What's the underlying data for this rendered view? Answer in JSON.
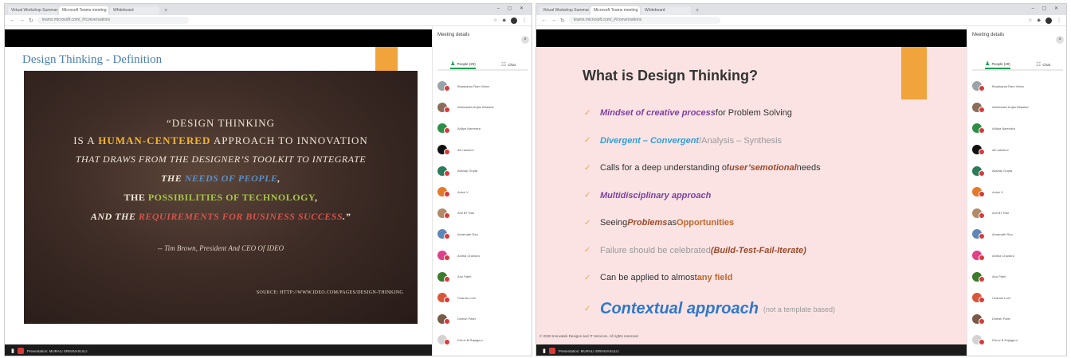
{
  "browser": {
    "tabs": [
      "Virtual Workshop Summary",
      "Microsoft Teams meeting",
      "Whiteboard"
    ],
    "url": "teams.microsoft.com/_#/conversations",
    "new_tab_label": "+",
    "window_controls": "–  ▢  ✕",
    "nav_back": "←",
    "nav_forward": "→",
    "nav_reload": "↻"
  },
  "left_slide": {
    "title": "Design Thinking - Definition",
    "quote_line1": "“DESIGN THINKING",
    "quote_line2_pre": "IS A ",
    "quote_line2_hl": "HUMAN-CENTERED",
    "quote_line2_post": " APPROACH TO INNOVATION",
    "quote_line3": "THAT DRAWS FROM THE DESIGNER’S TOOLKIT TO INTEGRATE",
    "quote_line4_pre": "THE ",
    "quote_line4_hl": "NEEDS OF PEOPLE",
    "quote_line4_post": ",",
    "quote_line5_pre": "THE ",
    "quote_line5_hl": "POSSIBILITIES OF TECHNOLOGY",
    "quote_line5_post": ",",
    "quote_line6_pre": "AND THE ",
    "quote_line6_hl": "REQUIREMENTS FOR BUSINESS SUCCESS",
    "quote_line6_post": ".”",
    "author": "-- Tim Brown, President And CEO Of IDEO",
    "source": "SOURCE: HTTP://WWW.IDEO.COM/PAGES/DESIGN-THINKING"
  },
  "right_slide": {
    "title": "What is Design Thinking?",
    "b1_hl": "Mindset of creative process",
    "b1_rest": " for Problem Solving",
    "b2_hl": "Divergent – Convergent",
    "b2_rest": "/Analysis – Synthesis",
    "b3_pre": "Calls for a deep understanding of ",
    "b3_hl1": "user’s",
    "b3_mid": " ",
    "b3_hl2": "emotional",
    "b3_post": " needs",
    "b4_hl": "Multidisciplinary approach",
    "b5_pre": "Seeing ",
    "b5_hl1": "Problems",
    "b5_mid": " as ",
    "b5_hl2": "Opportunities",
    "b6_pre": "Failure should be celebrated ",
    "b6_hl": "(Build-Test-Fail-Iterate)",
    "b7_pre": "Can be applied to almost ",
    "b7_hl": "any field",
    "b8_hl": "Contextual approach",
    "b8_note": "(not a template based)",
    "tick": "✓",
    "copyright": "© 2020 Innovatek Designs and IT Services. All rights reserved."
  },
  "presenter": {
    "label": "Presentation: MURALI SRINIVASULU"
  },
  "panel": {
    "title": "Meeting details",
    "close": "×",
    "tab_people": "People (20)",
    "tab_chat": "Chat",
    "people_icon": "♟",
    "chat_icon": "☷",
    "participants": [
      {
        "name": "Bhaskaran Ram Velan",
        "color": "#9aa3a8"
      },
      {
        "name": "Abhinaash Anjan Bhaskar",
        "color": "#8a6d5a"
      },
      {
        "name": "Aditya Narendra",
        "color": "#2f8d4a"
      },
      {
        "name": "All Lakshmi",
        "color": "#111111"
      },
      {
        "name": "Akshay Gupta",
        "color": "#2b7a5a"
      },
      {
        "name": "Anish V",
        "color": "#e27a2c"
      },
      {
        "name": "Anil BT Rao",
        "color": "#b08a6a"
      },
      {
        "name": "Amarnath Rao",
        "color": "#5f86b8"
      },
      {
        "name": "Anitha Chandra",
        "color": "#e0408a"
      },
      {
        "name": "Anu Patel",
        "color": "#3c7a2c"
      },
      {
        "name": "Chandu Lohi",
        "color": "#d8573a"
      },
      {
        "name": "Dinesh Patel",
        "color": "#7a5a48"
      },
      {
        "name": "Dhruv B Rajaguru",
        "color": "#d3d3d3"
      }
    ]
  }
}
